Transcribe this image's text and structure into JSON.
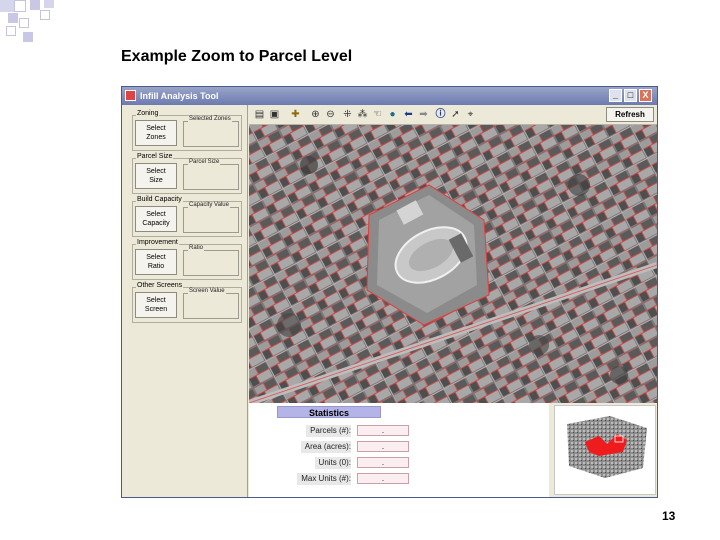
{
  "slide": {
    "title": "Example Zoom to Parcel Level",
    "page_number": "13"
  },
  "window": {
    "title": "Infill Analysis Tool",
    "controls": {
      "minimize": "_",
      "maximize": "□",
      "close": "X"
    }
  },
  "left_panel": {
    "groups": [
      {
        "label": "Zoning",
        "button_line1": "Select",
        "button_line2": "Zones",
        "field_label": "Selected Zones"
      },
      {
        "label": "Parcel Size",
        "button_line1": "Select",
        "button_line2": "Size",
        "field_label": "Parcel Size"
      },
      {
        "label": "Build Capacity",
        "button_line1": "Select",
        "button_line2": "Capacity",
        "field_label": "Capacity Value"
      },
      {
        "label": "Improvement",
        "button_line1": "Select",
        "button_line2": "Ratio",
        "field_label": "Ratio"
      },
      {
        "label": "Other Screens",
        "button_line1": "Select",
        "button_line2": "Screen",
        "field_label": "Screen Value"
      }
    ]
  },
  "toolbar": {
    "icons": [
      "open-icon",
      "save-icon",
      "add-data-icon",
      "zoom-in-icon",
      "zoom-out-icon",
      "fixed-zoom-in-icon",
      "fixed-zoom-out-icon",
      "pan-icon",
      "globe-icon",
      "back-icon",
      "forward-icon",
      "info-icon",
      "select-icon",
      "measure-icon"
    ],
    "refresh_label": "Refresh"
  },
  "statistics": {
    "title": "Statistics",
    "rows": [
      {
        "label": "Parcels (#):",
        "value": "."
      },
      {
        "label": "Area (acres):",
        "value": "."
      },
      {
        "label": "Units (0):",
        "value": "."
      },
      {
        "label": "Max Units (#):",
        "value": "."
      }
    ]
  },
  "colors": {
    "accent_blue": "#2b3a8a",
    "parcel_lines": "#e02020",
    "stats_header": "#b4b4e8"
  }
}
